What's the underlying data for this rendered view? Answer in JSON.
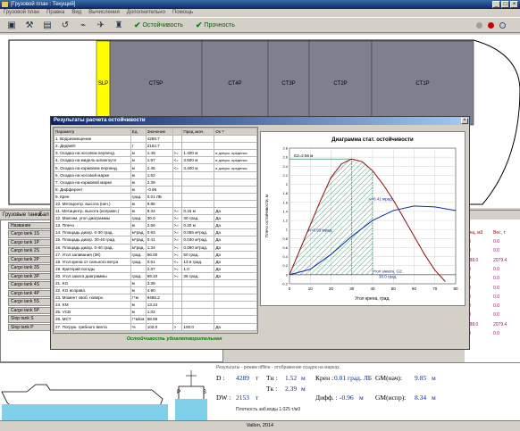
{
  "window": {
    "title": "[Грузовой план : Текущий]",
    "controls": [
      "_",
      "□",
      "×"
    ]
  },
  "menu": [
    "Грузовой план",
    "Правка",
    "Вид",
    "Вычисления",
    "Дополнительно",
    "Помощь"
  ],
  "toolbar": {
    "stability_label": "Остойчивость",
    "strength_label": "Прочность",
    "accent": "#0a8a0a"
  },
  "holds": [
    {
      "label": "SLP",
      "color": "#ffff00"
    },
    {
      "label": "CT5P",
      "color": "#7f7f8f"
    },
    {
      "label": "CT4P",
      "color": "#7f7f8f"
    },
    {
      "label": "CT3P",
      "color": "#7f7f8f"
    },
    {
      "label": "CT2P",
      "color": "#7f7f8f"
    },
    {
      "label": "CT1P",
      "color": "#7f7f8f"
    }
  ],
  "status_tabs": [
    "Грузовые танки",
    "Бал"
  ],
  "tanks": {
    "header": "Название",
    "rows": [
      "Cargo tank 1S",
      "Cargo tank 1P",
      "Cargo tank 2S",
      "Cargo tank 2P",
      "Cargo tank 3S",
      "Cargo tank 3P",
      "Cargo tank 4S",
      "Cargo tank 4P",
      "Cargo tank 5S",
      "Cargo tank 5P",
      "Slop tank S",
      "Slop tank P"
    ]
  },
  "right_values": {
    "header1": "Конц, м3",
    "header2": "Вес, т",
    "rows": [
      [
        "0.0",
        "0.0"
      ],
      [
        "0.0",
        "0.0"
      ],
      [
        "2888.0",
        "2079.4"
      ],
      [
        "0.0",
        "0.0"
      ],
      [
        "0.0",
        "0.0"
      ],
      [
        "0.0",
        "0.0"
      ],
      [
        "0.0",
        "0.0"
      ],
      [
        "0.0",
        "0.0"
      ],
      [
        "0.0",
        "0.0"
      ],
      [
        "2888.0",
        "2079.4"
      ],
      [
        "0.0",
        "0.0"
      ]
    ]
  },
  "dialog": {
    "title": "Результаты расчета остойчивости",
    "columns": [
      "Параметр",
      "Ед.",
      "Значение",
      "",
      "Пред.знач.",
      "Ок ?"
    ],
    "rows": [
      [
        "1. Водоизмещение",
        "",
        "4289.7",
        "",
        "",
        ""
      ],
      [
        "2. Дедвейт",
        "т",
        "2152.7",
        "",
        "",
        ""
      ],
      [
        "3. Осадка на носовом перпенд.",
        "м",
        "1.49",
        ">=",
        "1.400 м",
        "в допуск. пределах"
      ],
      [
        "4. Осадка на мидель-шпангоуте",
        "м",
        "1.97",
        "<=",
        "3.600 м",
        "в допуск. пределах"
      ],
      [
        "5. Осадка на кормовом перпенд.",
        "м",
        "2.45",
        "<=",
        "3.400 м",
        "в допуск. пределах"
      ],
      [
        "6. Осадка на носовой марке",
        "м",
        "1.52",
        "",
        "",
        ""
      ],
      [
        "7. Осадка на кормовой марке",
        "м",
        "2.39",
        "",
        "",
        ""
      ],
      [
        "8. Дифферент",
        "м",
        "-0.96",
        "",
        "",
        ""
      ],
      [
        "9. Крен",
        "град.",
        "0.01 ЛБ",
        "",
        "",
        ""
      ],
      [
        "10. Метацентр. высота (нач.)",
        "м",
        "9.85",
        "",
        "",
        ""
      ],
      [
        "11. Метацентр. высота (исправл.)",
        "м",
        "8.34",
        ">=",
        "0.15 м",
        "Да"
      ],
      [
        "12. Максим. угол диаграммы",
        "град.",
        "30.0",
        ">=",
        "30 град.",
        "Да"
      ],
      [
        "13. Плечо",
        "м",
        "2.56",
        ">=",
        "0.20 м",
        "Да"
      ],
      [
        "14. Площадь диагр. 0-30 град.",
        "м*рад.",
        "0.93",
        ">=",
        "0.055 м*рад.",
        "Да"
      ],
      [
        "15. Площадь диагр. 30-40 град.",
        "м*рад.",
        "0.41",
        ">=",
        "0.030 м*рад.",
        "Да"
      ],
      [
        "16. Площадь диагр. 0-40 град.",
        "м*рад.",
        "1.34",
        ">=",
        "0.090 м*рад.",
        "Да"
      ],
      [
        "17. Угол заливания (ЗК)",
        "град.",
        "56.00",
        ">=",
        "50 град.",
        "Да"
      ],
      [
        "18. Угол крена от сильного ветра",
        "град.",
        "0.51",
        "<=",
        "13.6 град.",
        "Да"
      ],
      [
        "19. Критерий погоды",
        "",
        "2.37",
        ">=",
        "1.0",
        "Да"
      ],
      [
        "20. Угол заката диаграммы",
        "град.",
        "69.10",
        ">=",
        "36 град.",
        "Да"
      ],
      [
        "21. KG",
        "м",
        "3.39",
        "",
        "",
        ""
      ],
      [
        "22. KG исправл.",
        "м",
        "4.90",
        "",
        "",
        ""
      ],
      [
        "23. Момент своб. поверх.",
        "т*м",
        "6465.2",
        "",
        "",
        ""
      ],
      [
        "24. KM",
        "м",
        "13.24",
        "",
        "",
        ""
      ],
      [
        "25. VCB",
        "м",
        "1.02",
        "",
        "",
        ""
      ],
      [
        "26. MCT",
        "т*м/см",
        "68.55",
        "",
        "",
        ""
      ],
      [
        "27. Погруж. грибного винта",
        "%",
        "102.0",
        ">",
        "100.0",
        "Да"
      ]
    ],
    "ok_text": "Остойчивость удовлетворительная"
  },
  "chart_data": {
    "type": "line",
    "title": "Диаграмма стат. остойчивости",
    "xlabel": "Угол крена, град.",
    "ylabel": "Плечо остойчивости, м",
    "xlim": [
      0,
      80
    ],
    "ylim": [
      -0.2,
      2.8
    ],
    "xticks": [
      0,
      10,
      20,
      30,
      40,
      50,
      60,
      70,
      80
    ],
    "yticks": [
      -0.2,
      0,
      0.2,
      0.4,
      0.6,
      0.8,
      1,
      1.2,
      1.4,
      1.6,
      1.8,
      2,
      2.2,
      2.4,
      2.6,
      2.8
    ],
    "series": [
      {
        "color": "#8b1010",
        "x": [
          0,
          5,
          10,
          15,
          20,
          25,
          30,
          35,
          40,
          45,
          50,
          55,
          60,
          65,
          70,
          73,
          75
        ],
        "y": [
          0,
          0.55,
          1.1,
          1.65,
          2.15,
          2.45,
          2.56,
          2.5,
          2.3,
          2.0,
          1.65,
          1.25,
          0.85,
          0.45,
          0.1,
          -0.05,
          -0.15
        ]
      },
      {
        "color": "#0a2aa0",
        "x": [
          0,
          10,
          20,
          30,
          40,
          50,
          60,
          70,
          80
        ],
        "y": [
          0,
          0.12,
          0.45,
          0.85,
          1.2,
          1.42,
          1.52,
          1.5,
          1.42
        ]
      }
    ],
    "annotations": [
      "G2=2.56 м",
      "A=0.41 мрад.",
      "A=0.93 мрад.",
      "Угол заката, G2:",
      "30.0 град."
    ],
    "grid": true
  },
  "summary": {
    "status": "Результаты - режим offline - отображение осадок на марках",
    "D_label": "D :",
    "D_value": "4289",
    "D_unit": "т",
    "Tn_label": "Tн :",
    "Tn_value": "1.52",
    "Tn_unit": "м",
    "heel_label": "Крен :",
    "heel_value": "0.01 град. ЛБ",
    "gm_initial_label": "GM(нач):",
    "gm_initial_value": "9.85",
    "gm_initial_unit": "м",
    "DW_label": "DW :",
    "DW_value": "2153",
    "DW_unit": "т",
    "Tk_label": "Tк :",
    "Tk_value": "2.39",
    "Tk_unit": "м",
    "trim_label": "Дифф. :",
    "trim_value": "-0.96",
    "trim_unit": "м",
    "gm_corr_label": "GM(испр):",
    "gm_corr_value": "8.34",
    "gm_corr_unit": "м",
    "density": "Плотность заб.воды 1.025 т/м3",
    "footer": "Vallon, 2014",
    "P": "P",
    "S": "S"
  }
}
